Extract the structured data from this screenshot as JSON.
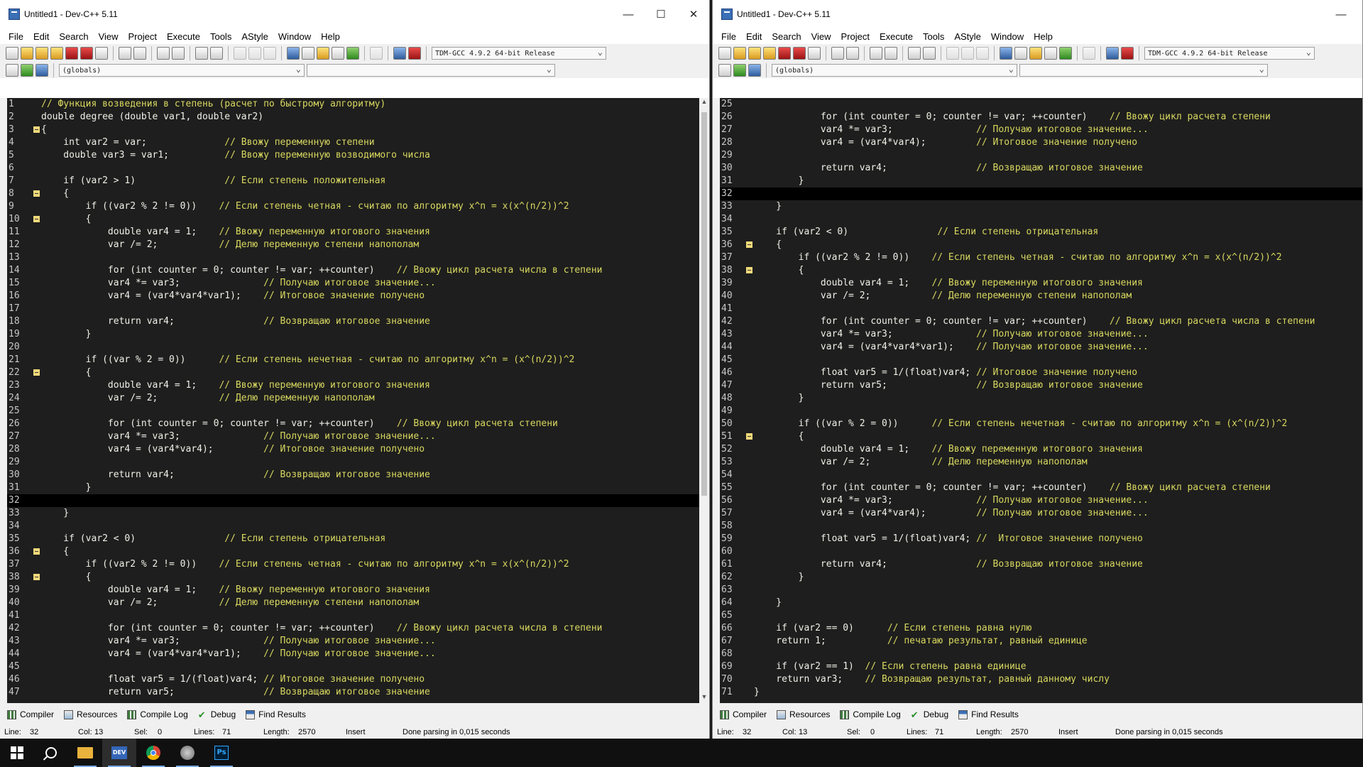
{
  "windows": [
    {
      "title": "Untitled1 - Dev-C++ 5.11",
      "menu": [
        "File",
        "Edit",
        "Search",
        "View",
        "Project",
        "Execute",
        "Tools",
        "AStyle",
        "Window",
        "Help"
      ],
      "compiler_select": "TDM-GCC 4.9.2 64-bit Release",
      "scope_select": "(globals)",
      "current_line": 32,
      "lines": [
        {
          "n": 1,
          "code": "",
          "comment": "// Функция возведения в степень (расчет по быстрому алгоритму)",
          "fold": ""
        },
        {
          "n": 2,
          "code": "double degree (double var1, double var2)",
          "comment": "",
          "fold": ""
        },
        {
          "n": 3,
          "code": "{",
          "comment": "",
          "fold": "box"
        },
        {
          "n": 4,
          "code": "    int var2 = var;              ",
          "comment": "// Ввожу переменную степени",
          "fold": ""
        },
        {
          "n": 5,
          "code": "    double var3 = var1;          ",
          "comment": "// Ввожу переменную возводимого числа",
          "fold": ""
        },
        {
          "n": 6,
          "code": "",
          "comment": "",
          "fold": ""
        },
        {
          "n": 7,
          "code": "    if (var2 > 1)                ",
          "comment": "// Если степень положительная",
          "fold": ""
        },
        {
          "n": 8,
          "code": "    {",
          "comment": "",
          "fold": "box"
        },
        {
          "n": 9,
          "code": "        if ((var2 % 2 != 0))    ",
          "comment": "// Если степень четная - считаю по алгоритму x^n = x(x^(n/2))^2",
          "fold": ""
        },
        {
          "n": 10,
          "code": "        {",
          "comment": "",
          "fold": "box"
        },
        {
          "n": 11,
          "code": "            double var4 = 1;    ",
          "comment": "// Ввожу переменную итогового значения",
          "fold": ""
        },
        {
          "n": 12,
          "code": "            var /= 2;           ",
          "comment": "// Делю переменную степени напополам",
          "fold": ""
        },
        {
          "n": 13,
          "code": "",
          "comment": "",
          "fold": ""
        },
        {
          "n": 14,
          "code": "            for (int counter = 0; counter != var; ++counter)    ",
          "comment": "// Ввожу цикл расчета числа в степени",
          "fold": ""
        },
        {
          "n": 15,
          "code": "            var4 *= var3;               ",
          "comment": "// Получаю итоговое значение...",
          "fold": ""
        },
        {
          "n": 16,
          "code": "            var4 = (var4*var4*var1);    ",
          "comment": "// Итоговое значение получено",
          "fold": ""
        },
        {
          "n": 17,
          "code": "",
          "comment": "",
          "fold": ""
        },
        {
          "n": 18,
          "code": "            return var4;                ",
          "comment": "// Возвращаю итоговое значение",
          "fold": ""
        },
        {
          "n": 19,
          "code": "        }",
          "comment": "",
          "fold": ""
        },
        {
          "n": 20,
          "code": "",
          "comment": "",
          "fold": ""
        },
        {
          "n": 21,
          "code": "        if ((var % 2 = 0))      ",
          "comment": "// Если степень нечетная - считаю по алгоритму x^n = (x^(n/2))^2",
          "fold": ""
        },
        {
          "n": 22,
          "code": "        {",
          "comment": "",
          "fold": "box"
        },
        {
          "n": 23,
          "code": "            double var4 = 1;    ",
          "comment": "// Ввожу переменную итогового значения",
          "fold": ""
        },
        {
          "n": 24,
          "code": "            var /= 2;           ",
          "comment": "// Делю переменную напополам",
          "fold": ""
        },
        {
          "n": 25,
          "code": "",
          "comment": "",
          "fold": ""
        },
        {
          "n": 26,
          "code": "            for (int counter = 0; counter != var; ++counter)    ",
          "comment": "// Ввожу цикл расчета степени",
          "fold": ""
        },
        {
          "n": 27,
          "code": "            var4 *= var3;               ",
          "comment": "// Получаю итоговое значение...",
          "fold": ""
        },
        {
          "n": 28,
          "code": "            var4 = (var4*var4);         ",
          "comment": "// Итоговое значение получено",
          "fold": ""
        },
        {
          "n": 29,
          "code": "",
          "comment": "",
          "fold": ""
        },
        {
          "n": 30,
          "code": "            return var4;                ",
          "comment": "// Возвращаю итоговое значение",
          "fold": ""
        },
        {
          "n": 31,
          "code": "        }",
          "comment": "",
          "fold": ""
        },
        {
          "n": 32,
          "code": "",
          "comment": "",
          "fold": ""
        },
        {
          "n": 33,
          "code": "    }",
          "comment": "",
          "fold": ""
        },
        {
          "n": 34,
          "code": "",
          "comment": "",
          "fold": ""
        },
        {
          "n": 35,
          "code": "    if (var2 < 0)                ",
          "comment": "// Если степень отрицательная",
          "fold": ""
        },
        {
          "n": 36,
          "code": "    {",
          "comment": "",
          "fold": "box"
        },
        {
          "n": 37,
          "code": "        if ((var2 % 2 != 0))    ",
          "comment": "// Если степень четная - считаю по алгоритму x^n = x(x^(n/2))^2",
          "fold": ""
        },
        {
          "n": 38,
          "code": "        {",
          "comment": "",
          "fold": "box"
        },
        {
          "n": 39,
          "code": "            double var4 = 1;    ",
          "comment": "// Ввожу переменную итогового значения",
          "fold": ""
        },
        {
          "n": 40,
          "code": "            var /= 2;           ",
          "comment": "// Делю переменную степени напополам",
          "fold": ""
        },
        {
          "n": 41,
          "code": "",
          "comment": "",
          "fold": ""
        },
        {
          "n": 42,
          "code": "            for (int counter = 0; counter != var; ++counter)    ",
          "comment": "// Ввожу цикл расчета числа в степени",
          "fold": ""
        },
        {
          "n": 43,
          "code": "            var4 *= var3;               ",
          "comment": "// Получаю итоговое значение...",
          "fold": ""
        },
        {
          "n": 44,
          "code": "            var4 = (var4*var4*var1);    ",
          "comment": "// Получаю итоговое значение...",
          "fold": ""
        },
        {
          "n": 45,
          "code": "",
          "comment": "",
          "fold": ""
        },
        {
          "n": 46,
          "code": "            float var5 = 1/(float)var4; ",
          "comment": "// Итоговое значение получено",
          "fold": ""
        },
        {
          "n": 47,
          "code": "            return var5;                ",
          "comment": "// Возвращаю итоговое значение",
          "fold": ""
        }
      ],
      "bottom_tabs": [
        "Compiler",
        "Resources",
        "Compile Log",
        "Debug",
        "Find Results"
      ],
      "status": {
        "line_label": "Line:",
        "line": "32",
        "col_label": "Col:",
        "col": "13",
        "sel_label": "Sel:",
        "sel": "0",
        "lines_label": "Lines:",
        "lines": "71",
        "length_label": "Length:",
        "length": "2570",
        "mode": "Insert",
        "message": "Done parsing in 0,015 seconds"
      }
    },
    {
      "title": "Untitled1 - Dev-C++ 5.11",
      "menu": [
        "File",
        "Edit",
        "Search",
        "View",
        "Project",
        "Execute",
        "Tools",
        "AStyle",
        "Window",
        "Help"
      ],
      "compiler_select": "TDM-GCC 4.9.2 64-bit Release",
      "scope_select": "(globals)",
      "current_line": 32,
      "lines": [
        {
          "n": 25,
          "code": "",
          "comment": "",
          "fold": ""
        },
        {
          "n": 26,
          "code": "            for (int counter = 0; counter != var; ++counter)    ",
          "comment": "// Ввожу цикл расчета степени",
          "fold": ""
        },
        {
          "n": 27,
          "code": "            var4 *= var3;               ",
          "comment": "// Получаю итоговое значение...",
          "fold": ""
        },
        {
          "n": 28,
          "code": "            var4 = (var4*var4);         ",
          "comment": "// Итоговое значение получено",
          "fold": ""
        },
        {
          "n": 29,
          "code": "",
          "comment": "",
          "fold": ""
        },
        {
          "n": 30,
          "code": "            return var4;                ",
          "comment": "// Возвращаю итоговое значение",
          "fold": ""
        },
        {
          "n": 31,
          "code": "        }",
          "comment": "",
          "fold": ""
        },
        {
          "n": 32,
          "code": "",
          "comment": "",
          "fold": ""
        },
        {
          "n": 33,
          "code": "    }",
          "comment": "",
          "fold": ""
        },
        {
          "n": 34,
          "code": "",
          "comment": "",
          "fold": ""
        },
        {
          "n": 35,
          "code": "    if (var2 < 0)                ",
          "comment": "// Если степень отрицательная",
          "fold": ""
        },
        {
          "n": 36,
          "code": "    {",
          "comment": "",
          "fold": "box"
        },
        {
          "n": 37,
          "code": "        if ((var2 % 2 != 0))    ",
          "comment": "// Если степень четная - считаю по алгоритму x^n = x(x^(n/2))^2",
          "fold": ""
        },
        {
          "n": 38,
          "code": "        {",
          "comment": "",
          "fold": "box"
        },
        {
          "n": 39,
          "code": "            double var4 = 1;    ",
          "comment": "// Ввожу переменную итогового значения",
          "fold": ""
        },
        {
          "n": 40,
          "code": "            var /= 2;           ",
          "comment": "// Делю переменную степени напополам",
          "fold": ""
        },
        {
          "n": 41,
          "code": "",
          "comment": "",
          "fold": ""
        },
        {
          "n": 42,
          "code": "            for (int counter = 0; counter != var; ++counter)    ",
          "comment": "// Ввожу цикл расчета числа в степени",
          "fold": ""
        },
        {
          "n": 43,
          "code": "            var4 *= var3;               ",
          "comment": "// Получаю итоговое значение...",
          "fold": ""
        },
        {
          "n": 44,
          "code": "            var4 = (var4*var4*var1);    ",
          "comment": "// Получаю итоговое значение...",
          "fold": ""
        },
        {
          "n": 45,
          "code": "",
          "comment": "",
          "fold": ""
        },
        {
          "n": 46,
          "code": "            float var5 = 1/(float)var4; ",
          "comment": "// Итоговое значение получено",
          "fold": ""
        },
        {
          "n": 47,
          "code": "            return var5;                ",
          "comment": "// Возвращаю итоговое значение",
          "fold": ""
        },
        {
          "n": 48,
          "code": "        }",
          "comment": "",
          "fold": ""
        },
        {
          "n": 49,
          "code": "",
          "comment": "",
          "fold": ""
        },
        {
          "n": 50,
          "code": "        if ((var % 2 = 0))      ",
          "comment": "// Если степень нечетная - считаю по алгоритму x^n = (x^(n/2))^2",
          "fold": ""
        },
        {
          "n": 51,
          "code": "        {",
          "comment": "",
          "fold": "box"
        },
        {
          "n": 52,
          "code": "            double var4 = 1;    ",
          "comment": "// Ввожу переменную итогового значения",
          "fold": ""
        },
        {
          "n": 53,
          "code": "            var /= 2;           ",
          "comment": "// Делю переменную напополам",
          "fold": ""
        },
        {
          "n": 54,
          "code": "",
          "comment": "",
          "fold": ""
        },
        {
          "n": 55,
          "code": "            for (int counter = 0; counter != var; ++counter)    ",
          "comment": "// Ввожу цикл расчета степени",
          "fold": ""
        },
        {
          "n": 56,
          "code": "            var4 *= var3;               ",
          "comment": "// Получаю итоговое значение...",
          "fold": ""
        },
        {
          "n": 57,
          "code": "            var4 = (var4*var4);         ",
          "comment": "// Получаю итоговое значение...",
          "fold": ""
        },
        {
          "n": 58,
          "code": "",
          "comment": "",
          "fold": ""
        },
        {
          "n": 59,
          "code": "            float var5 = 1/(float)var4; ",
          "comment": "//  Итоговое значение получено",
          "fold": ""
        },
        {
          "n": 60,
          "code": "",
          "comment": "",
          "fold": ""
        },
        {
          "n": 61,
          "code": "            return var4;                ",
          "comment": "// Возвращаю итоговое значение",
          "fold": ""
        },
        {
          "n": 62,
          "code": "        }",
          "comment": "",
          "fold": ""
        },
        {
          "n": 63,
          "code": "",
          "comment": "",
          "fold": ""
        },
        {
          "n": 64,
          "code": "    }",
          "comment": "",
          "fold": ""
        },
        {
          "n": 65,
          "code": "",
          "comment": "",
          "fold": ""
        },
        {
          "n": 66,
          "code": "    if (var2 == 0)      ",
          "comment": "// Если степень равна нулю",
          "fold": ""
        },
        {
          "n": 67,
          "code": "    return 1;           ",
          "comment": "// печатаю результат, равный единице",
          "fold": ""
        },
        {
          "n": 68,
          "code": "",
          "comment": "",
          "fold": ""
        },
        {
          "n": 69,
          "code": "    if (var2 == 1)  ",
          "comment": "// Если степень равна единице",
          "fold": ""
        },
        {
          "n": 70,
          "code": "    return var3;    ",
          "comment": "// Возвращаю результат, равный данному числу",
          "fold": ""
        },
        {
          "n": 71,
          "code": "}",
          "comment": "",
          "fold": ""
        }
      ],
      "bottom_tabs": [
        "Compiler",
        "Resources",
        "Compile Log",
        "Debug",
        "Find Results"
      ],
      "status": {
        "line_label": "Line:",
        "line": "32",
        "col_label": "Col:",
        "col": "13",
        "sel_label": "Sel:",
        "sel": "0",
        "lines_label": "Lines:",
        "lines": "71",
        "length_label": "Length:",
        "length": "2570",
        "mode": "Insert",
        "message": "Done parsing in 0,015 seconds"
      }
    }
  ],
  "taskbar": {
    "items": [
      "start-icon",
      "search-icon",
      "file-explorer-icon",
      "devcpp-icon",
      "chrome-icon",
      "app-icon",
      "photoshop-icon"
    ],
    "dev_label": "DEV",
    "ps_label": "Ps"
  },
  "colors": {
    "editor_bg": "#1e1e1e",
    "comment": "#d8d860",
    "code": "#f0f0e8",
    "current_line": "#000000"
  }
}
